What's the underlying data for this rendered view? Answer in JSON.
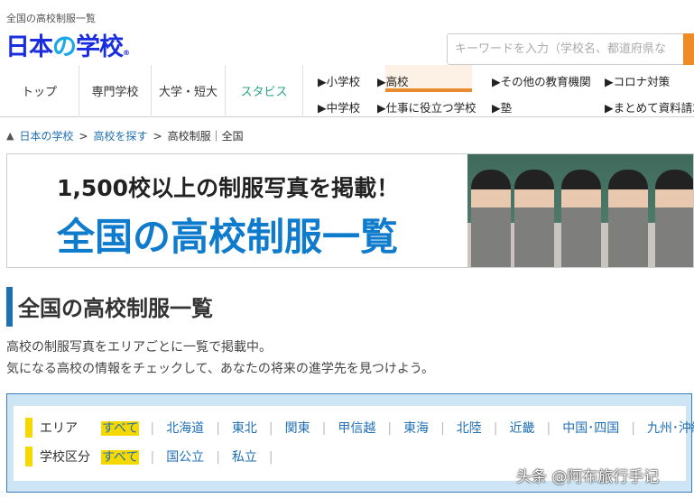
{
  "header": {
    "caption": "全国の高校制服一覧",
    "logo_a": "日本",
    "logo_no": "の",
    "logo_b": "学校",
    "logo_r": "®",
    "search_placeholder": "キーワードを入力（学校名、都道府県など）"
  },
  "nav": {
    "main": [
      "トップ",
      "専門学校",
      "大学・短大",
      "スタビス"
    ],
    "sub": [
      "▶小学校",
      "▶高校",
      "▶その他の教育機関",
      "▶コロナ対策",
      "▶中学校",
      "▶仕事に役立つ学校",
      "▶塾",
      "▶まとめて資料請求"
    ],
    "accent": "#ea8a2e"
  },
  "breadcrumb": [
    "日本の学校",
    ">",
    "高校を探す",
    ">",
    "高校制服｜全国"
  ],
  "banner": {
    "line1": "1,500校以上の制服写真を掲載！",
    "line2": "全国の高校制服一覧"
  },
  "page": {
    "title": "全国の高校制服一覧",
    "desc1": "高校の制服写真をエリアごとに一覧で掲載中。",
    "desc2": "気になる高校の情報をチェックして、あなたの将来の進学先を見つけよう。"
  },
  "filters": {
    "area_label": "エリア",
    "area_options": [
      "すべて",
      "北海道",
      "東北",
      "関東",
      "甲信越",
      "東海",
      "北陸",
      "近畿",
      "中国･四国",
      "九州･沖縄"
    ],
    "type_label": "学校区分",
    "type_options": [
      "すべて",
      "国公立",
      "私立"
    ]
  },
  "watermark": "头条 @阿布旅行手记"
}
